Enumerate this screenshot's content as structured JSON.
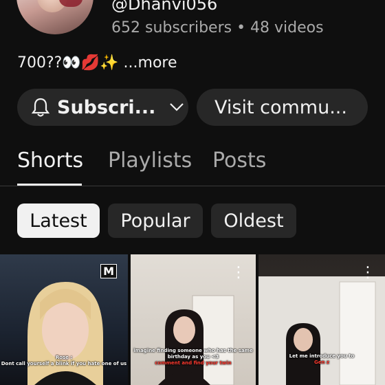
{
  "channel": {
    "handle": "@Dhanvi056",
    "stats": "652 subscribers • 48 videos",
    "description": "700??👀💋✨",
    "more_label": "...more"
  },
  "buttons": {
    "subscribe_label": "Subscri...",
    "visit_label": "Visit commu..."
  },
  "tabs": [
    "Shorts",
    "Playlists",
    "Posts"
  ],
  "filters": [
    "Latest",
    "Popular",
    "Oldest"
  ],
  "shorts": [
    {
      "badge": "M",
      "caption_title": "Rose :",
      "caption": "Dont call yourself a blink if you hate one of us"
    },
    {
      "caption": "imagine finding someone who has the same birthday as you <3",
      "caption_highlight": "comment and find your twin"
    },
    {
      "caption": "Let me introduce you to",
      "caption_highlight": "Gen z"
    }
  ],
  "colors": {
    "background": "#0f0f0f",
    "surface": "#272727",
    "text": "#f1f1f1",
    "muted": "#aaaaaa"
  }
}
